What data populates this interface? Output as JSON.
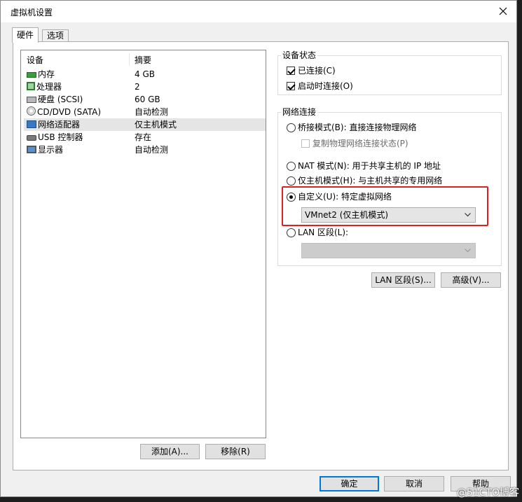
{
  "window": {
    "title": "虚拟机设置"
  },
  "tabs": [
    {
      "label": "硬件",
      "active": true
    },
    {
      "label": "选项",
      "active": false
    }
  ],
  "devices": {
    "header": {
      "device": "设备",
      "summary": "摘要"
    },
    "rows": [
      {
        "name": "内存",
        "summary": "4 GB",
        "icon": "memory-icon"
      },
      {
        "name": "处理器",
        "summary": "2",
        "icon": "processor-icon"
      },
      {
        "name": "硬盘 (SCSI)",
        "summary": "60 GB",
        "icon": "hard-disk-icon"
      },
      {
        "name": "CD/DVD (SATA)",
        "summary": "自动检测",
        "icon": "cd-dvd-icon"
      },
      {
        "name": "网络适配器",
        "summary": "仅主机模式",
        "icon": "network-adapter-icon",
        "selected": true
      },
      {
        "name": "USB 控制器",
        "summary": "存在",
        "icon": "usb-icon"
      },
      {
        "name": "显示器",
        "summary": "自动检测",
        "icon": "display-icon"
      }
    ],
    "add_label": "添加(A)...",
    "remove_label": "移除(R)"
  },
  "device_status": {
    "title": "设备状态",
    "connected": "已连接(C)",
    "connect_at_power_on": "启动时连接(O)"
  },
  "network": {
    "title": "网络连接",
    "bridged": "桥接模式(B): 直接连接物理网络",
    "replicate": "复制物理网络连接状态(P)",
    "nat": "NAT 模式(N): 用于共享主机的 IP 地址",
    "host_only": "仅主机模式(H): 与主机共享的专用网络",
    "custom": "自定义(U): 特定虚拟网络",
    "custom_value": "VMnet2 (仅主机模式)",
    "lan_segment": "LAN 区段(L):",
    "lan_value": ""
  },
  "right_buttons": {
    "lan_segments": "LAN 区段(S)...",
    "advanced": "高级(V)..."
  },
  "footer": {
    "ok": "确定",
    "cancel": "取消",
    "help": "帮助"
  },
  "watermark": "@51CTO博客",
  "colors": {
    "accent": "#0078d7",
    "highlight": "#e02020"
  }
}
